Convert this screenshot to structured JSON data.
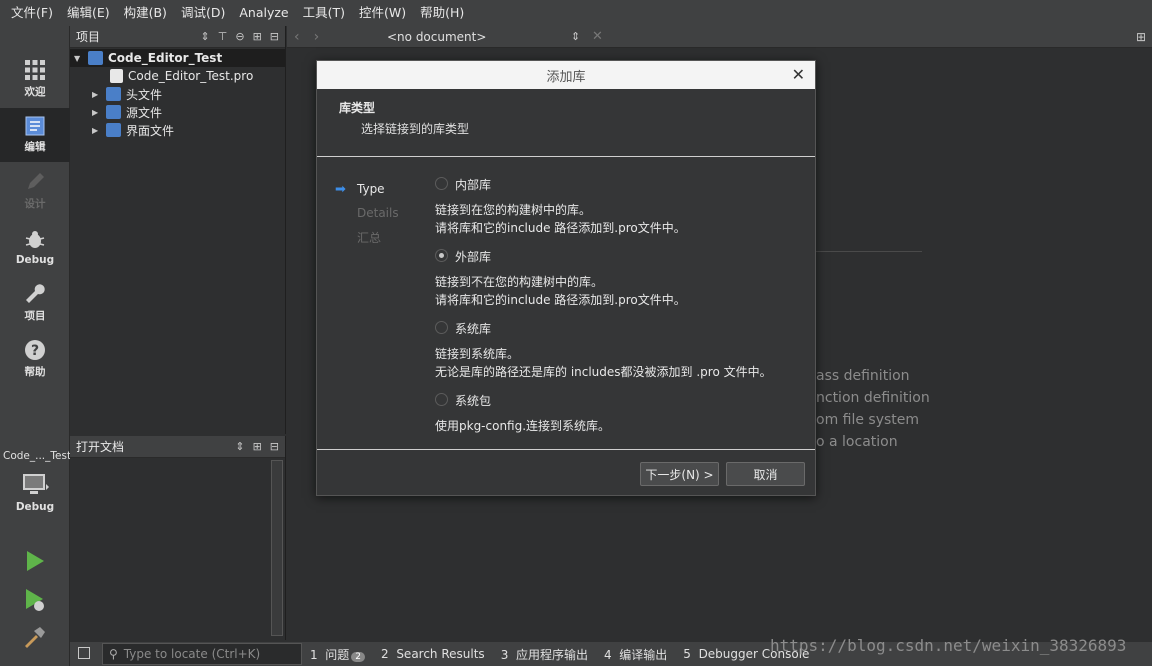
{
  "menu": [
    "文件(F)",
    "编辑(E)",
    "构建(B)",
    "调试(D)",
    "Analyze",
    "工具(T)",
    "控件(W)",
    "帮助(H)"
  ],
  "modes": [
    {
      "label": "欢迎",
      "icon": "grid-icon"
    },
    {
      "label": "编辑",
      "icon": "document-icon"
    },
    {
      "label": "设计",
      "icon": "pencil-icon"
    },
    {
      "label": "Debug",
      "icon": "bug-icon"
    },
    {
      "label": "项目",
      "icon": "wrench-icon"
    },
    {
      "label": "帮助",
      "icon": "help-icon"
    }
  ],
  "kit": {
    "project_name": "Code_..._Test",
    "config": "Debug"
  },
  "project_panel": {
    "title": "项目",
    "tree": [
      {
        "label": "Code_Editor_Test"
      },
      {
        "label": "Code_Editor_Test.pro"
      },
      {
        "label": "头文件"
      },
      {
        "label": "源文件"
      },
      {
        "label": "界面文件"
      }
    ]
  },
  "open_docs": {
    "title": "打开文档"
  },
  "editor_toolbar": {
    "document": "<no document>"
  },
  "welcome_links": [
    "ass definition",
    "nction definition",
    "om file system",
    "o a location"
  ],
  "dialog": {
    "title": "添加库",
    "header": "库类型",
    "subheader": "选择链接到的库类型",
    "steps": [
      "Type",
      "Details",
      "汇总"
    ],
    "options": [
      {
        "label": "内部库",
        "checked": false,
        "desc": [
          "链接到在您的构建树中的库。",
          "请将库和它的include 路径添加到.pro文件中。"
        ]
      },
      {
        "label": "外部库",
        "checked": true,
        "desc": [
          "链接到不在您的构建树中的库。",
          "请将库和它的include 路径添加到.pro文件中。"
        ]
      },
      {
        "label": "系统库",
        "checked": false,
        "desc": [
          "链接到系统库。",
          "无论是库的路径还是库的 includes都没被添加到 .pro 文件中。"
        ]
      },
      {
        "label": "系统包",
        "checked": false,
        "desc": [
          "使用pkg-config.连接到系统库。"
        ]
      }
    ],
    "next_button": "下一步(N) >",
    "cancel_button": "取消"
  },
  "output_bar": {
    "locate_placeholder": "Type to locate (Ctrl+K)",
    "tabs": [
      {
        "num": "1",
        "label": "问题",
        "badge": "2"
      },
      {
        "num": "2",
        "label": "Search Results"
      },
      {
        "num": "3",
        "label": "应用程序输出"
      },
      {
        "num": "4",
        "label": "编译输出"
      },
      {
        "num": "5",
        "label": "Debugger Console"
      }
    ]
  },
  "watermark": "https://blog.csdn.net/weixin_38326893"
}
